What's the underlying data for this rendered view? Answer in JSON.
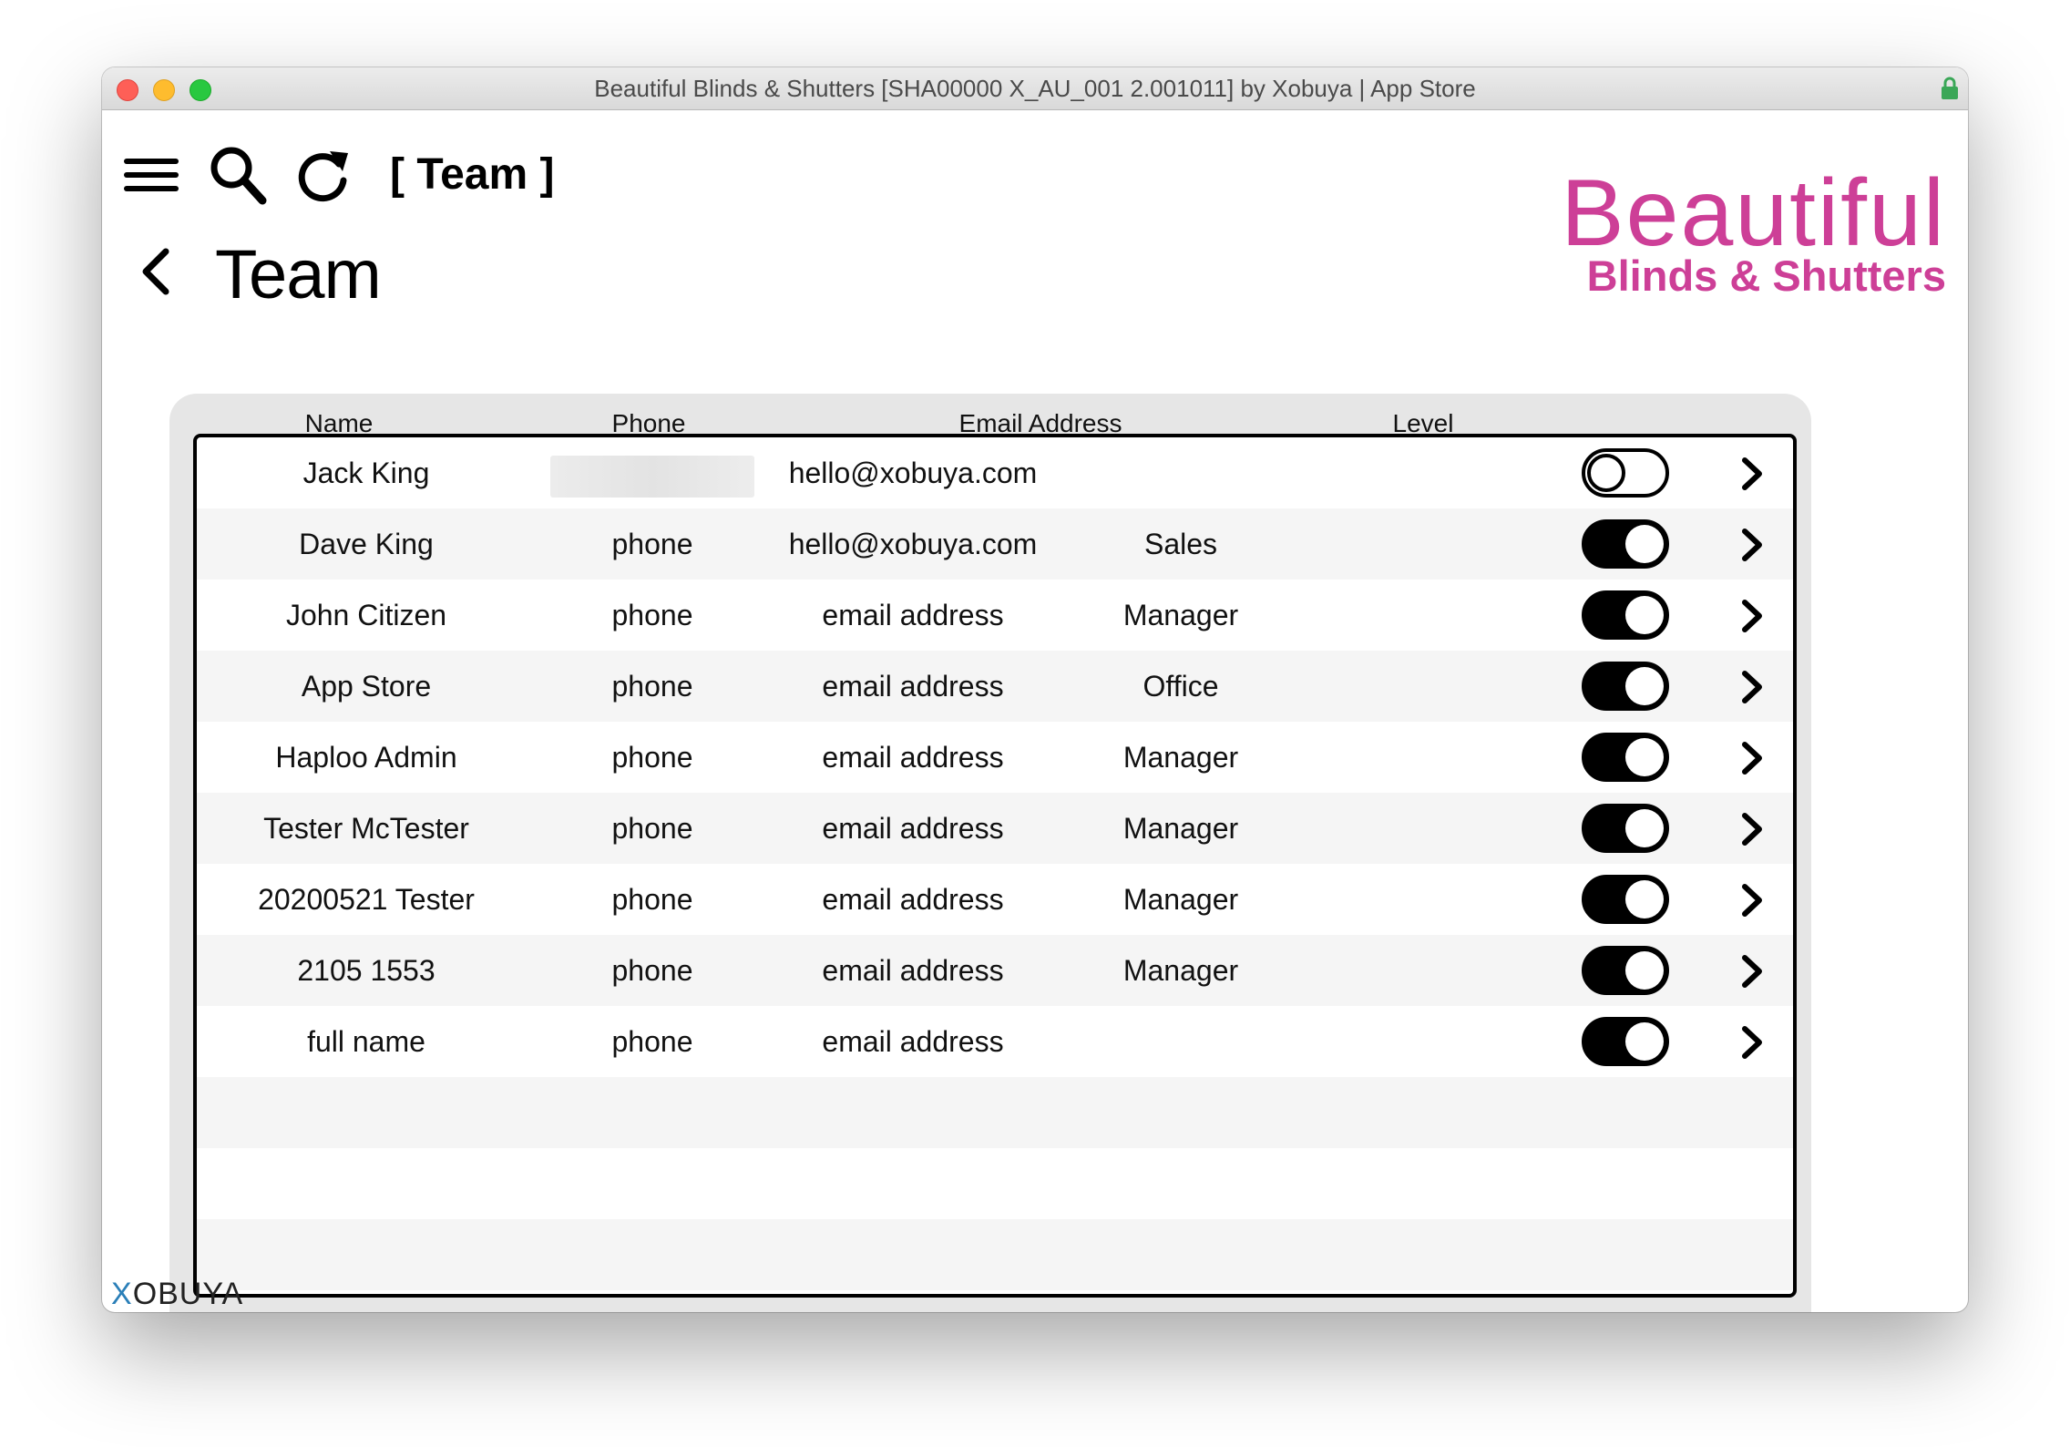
{
  "window": {
    "title": "Beautiful Blinds & Shutters [SHA00000 X_AU_001 2.001011] by Xobuya | App Store"
  },
  "toolbar": {
    "breadcrumb": "[ Team ]"
  },
  "page": {
    "title": "Team"
  },
  "logo": {
    "line1": "Beautiful",
    "line2": "Blinds & Shutters",
    "color": "#cd3f97"
  },
  "table": {
    "headers": {
      "name": "Name",
      "phone": "Phone",
      "email": "Email Address",
      "level": "Level"
    },
    "rows": [
      {
        "name": "Jack King",
        "phone": "",
        "email": "hello@xobuya.com",
        "level": "",
        "active": false
      },
      {
        "name": "Dave King",
        "phone": "phone",
        "email": "hello@xobuya.com",
        "level": "Sales",
        "active": true
      },
      {
        "name": "John Citizen",
        "phone": "phone",
        "email": "email address",
        "level": "Manager",
        "active": true
      },
      {
        "name": "App Store",
        "phone": "phone",
        "email": "email address",
        "level": "Office",
        "active": true
      },
      {
        "name": "Haploo Admin",
        "phone": "phone",
        "email": "email address",
        "level": "Manager",
        "active": true
      },
      {
        "name": "Tester McTester",
        "phone": "phone",
        "email": "email address",
        "level": "Manager",
        "active": true
      },
      {
        "name": "20200521 Tester",
        "phone": "phone",
        "email": "email address",
        "level": "Manager",
        "active": true
      },
      {
        "name": "2105 1553",
        "phone": "phone",
        "email": "email address",
        "level": "Manager",
        "active": true
      },
      {
        "name": "full name",
        "phone": "phone",
        "email": "email address",
        "level": "",
        "active": true
      }
    ]
  },
  "footer": {
    "brand_x": "X",
    "brand_rest": "OBUYA"
  }
}
